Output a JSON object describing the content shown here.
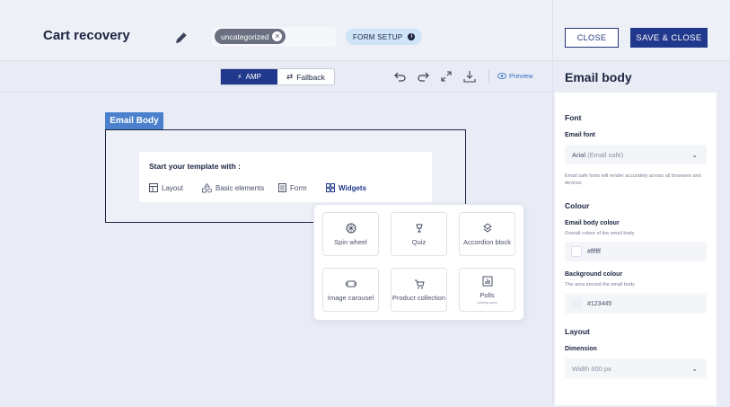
{
  "header": {
    "title": "Cart recovery",
    "tag_label": "uncategorized",
    "form_setup_label": "FORM SETUP",
    "close_label": "CLOSE",
    "save_close_label": "SAVE & CLOSE",
    "edit_icon": "pencil-icon"
  },
  "toolbar": {
    "amp_label": "AMP",
    "fallback_label": "Fallback",
    "preview_label": "Preview",
    "icons": [
      "undo-icon",
      "redo-icon",
      "expand-icon",
      "download-icon",
      "eye-icon"
    ]
  },
  "canvas": {
    "section_label": "Email Body",
    "start_title": "Start your template with :",
    "options": [
      {
        "label": "Layout",
        "icon": "layout-icon"
      },
      {
        "label": "Basic elements",
        "icon": "shapes-icon"
      },
      {
        "label": "Form",
        "icon": "form-icon"
      },
      {
        "label": "Widgets",
        "icon": "widgets-icon",
        "active": true
      }
    ]
  },
  "widgets": [
    {
      "label": "Spin wheel",
      "icon": "spin-wheel-icon"
    },
    {
      "label": "Quiz",
      "icon": "quiz-icon"
    },
    {
      "label": "Accordion block",
      "icon": "accordion-icon"
    },
    {
      "label": "Image carousel",
      "icon": "carousel-icon"
    },
    {
      "label": "Product collection",
      "icon": "cart-icon"
    },
    {
      "label": "Polls",
      "sub": "(coming soon)",
      "icon": "polls-icon"
    }
  ],
  "panel": {
    "title": "Email body",
    "font_section": "Font",
    "email_font_label": "Email font",
    "email_font_value": "Arial",
    "email_font_hint": "(Email safe)",
    "font_help": "Email safe fonts will render accurately across all browsers and devices",
    "colour_section": "Colour",
    "body_colour_label": "Email body colour",
    "body_colour_help": "Overall colour of the email body",
    "body_colour_value": "#ffffff",
    "bg_colour_label": "Background colour",
    "bg_colour_help": "The area around the email body",
    "bg_colour_value": "#123445",
    "layout_section": "Layout",
    "dimension_label": "Dimension",
    "dimension_value": "Width 600 px"
  },
  "colors": {
    "primary": "#21398c",
    "accent_blue": "#4a80cc",
    "tag_grey": "#6b7080",
    "form_setup_bg": "#cfe4f6"
  }
}
